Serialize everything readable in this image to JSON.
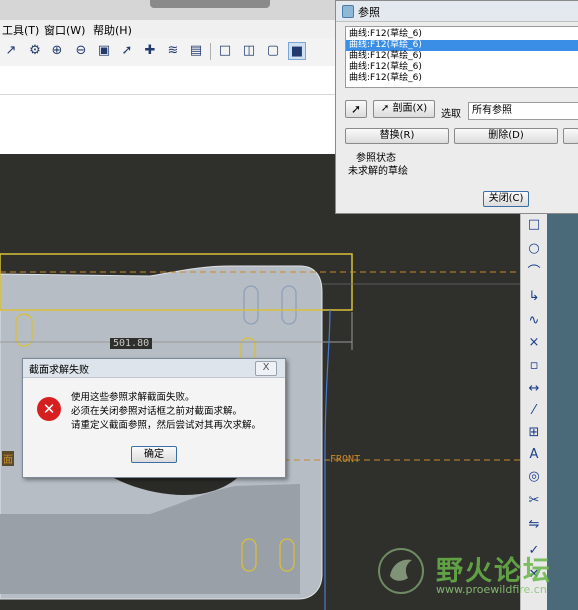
{
  "menubar": {
    "items": [
      "工具(T)",
      "窗口(W)",
      "帮助(H)"
    ]
  },
  "toolbar": {
    "icons": [
      "sketch-line-icon",
      "sketch-arc-icon",
      "zoom-in-icon",
      "zoom-out-icon",
      "zoom-fit-icon",
      "pointer-icon",
      "pointer-add-icon",
      "layers-icon",
      "view-manager-icon",
      "cube-wire-icon",
      "cube-hidden-icon",
      "cube-nohidden-icon",
      "cube-shade-icon"
    ]
  },
  "ref_dialog": {
    "title": "参照",
    "list": [
      "曲线:F12(草绘_6)",
      "曲线:F12(草绘_6)",
      "曲线:F12(草绘_6)",
      "曲线:F12(草绘_6)",
      "曲线:F12(草绘_6)"
    ],
    "selected_index": 1,
    "section_button": "剖面(X)",
    "select_label": "选取",
    "select_value": "所有参照",
    "replace_button": "替换(R)",
    "delete_button": "删除(D)",
    "status_title": "参照状态",
    "status_text": "未求解的草绘",
    "close_button": "关闭(C)"
  },
  "error_dialog": {
    "title": "截面求解失败",
    "close_glyph": "X",
    "lines": [
      "使用这些参照求解截面失败。",
      "必须在关闭参照对话框之前对截面求解。",
      "请重定义截面参照，然后尝试对其再次求解。"
    ],
    "ok_button": "确定"
  },
  "graphics": {
    "dimension_label": "501.80",
    "front_label": "FRONT",
    "left_label": "面"
  },
  "right_tools": {
    "icons": [
      "rectangle-icon",
      "circle-icon",
      "arc-icon",
      "fillet-icon",
      "spline-icon",
      "point-icon",
      "offset-icon",
      "dimension-icon",
      "modify-icon",
      "constraint-icon",
      "text-icon",
      "palette-icon",
      "trim-icon",
      "mirror-icon",
      "done-icon",
      "quit-icon"
    ]
  },
  "watermark": {
    "title": "野火论坛",
    "url": "www.proewildfire.cn"
  },
  "colors": {
    "selection": "#3a8ee6",
    "error_red": "#d62020",
    "sketch_yellow": "#d8c038",
    "datum_orange": "#c98a2a"
  }
}
